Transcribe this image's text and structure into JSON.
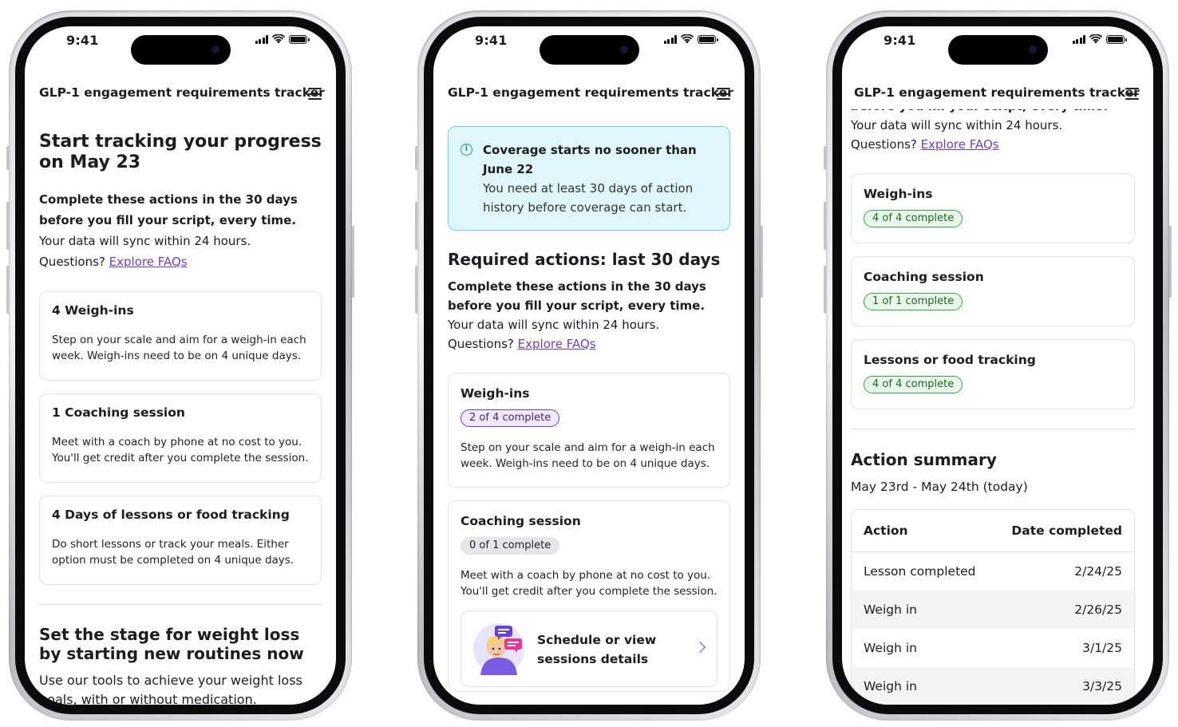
{
  "status_bar": {
    "time": "9:41"
  },
  "app": {
    "title": "GLP-1 engagement requirements tracker"
  },
  "screen1": {
    "heading": "Start tracking your progress on May 23",
    "intro_bold": "Complete these actions in the 30 days before you fill your script, every time.",
    "sync_text": "Your data will sync within 24 hours.",
    "questions_text": "Questions?",
    "faq_link": "Explore FAQs",
    "cards": [
      {
        "title": "4 Weigh-ins",
        "body": "Step on your scale and aim for a weigh-in each week. Weigh-ins need to be on 4 unique days."
      },
      {
        "title": "1 Coaching session",
        "body": "Meet with a coach by phone at no cost to you. You'll get credit after you complete the session."
      },
      {
        "title": "4 Days of lessons or food tracking",
        "body": "Do short lessons or track your meals. Either option must be completed on 4 unique days."
      }
    ],
    "section2_heading": "Set the stage for weight loss by starting new routines now",
    "section2_body": "Use our tools to achieve your weight loss goals, with or without medication."
  },
  "screen2": {
    "info_title": "Coverage starts no sooner than June 22",
    "info_body": "You need at least 30 days of action history before coverage can start.",
    "heading": "Required actions: last 30 days",
    "intro_bold": "Complete these actions in the 30 days before you fill your script, every time.",
    "sync_text": "Your data will sync within 24 hours.",
    "questions_text": "Questions?",
    "faq_link": "Explore FAQs",
    "weighins": {
      "title": "Weigh-ins",
      "status": "2 of 4 complete",
      "body": "Step on your scale and aim for a weigh-in each week. Weigh-ins need to be on 4 unique days."
    },
    "coaching": {
      "title": "Coaching session",
      "status": "0 of 1 complete",
      "body": "Meet with a coach by phone at no cost to you. You'll get credit after you complete the session."
    },
    "schedule_label": "Schedule or view sessions details"
  },
  "screen3": {
    "partial_top": "before you fill your script, every time.",
    "sync_text": "Your data will sync within 24 hours.",
    "questions_text": "Questions?",
    "faq_link": "Explore FAQs",
    "cards": [
      {
        "title": "Weigh-ins",
        "status": "4 of 4 complete"
      },
      {
        "title": "Coaching session",
        "status": "1 of 1 complete"
      },
      {
        "title": "Lessons or food tracking",
        "status": "4 of 4 complete"
      }
    ],
    "summary_heading": "Action summary",
    "summary_range": "May 23rd - May 24th (today)",
    "table": {
      "headers": [
        "Action",
        "Date completed"
      ],
      "rows": [
        [
          "Lesson completed",
          "2/24/25"
        ],
        [
          "Weigh in",
          "2/26/25"
        ],
        [
          "Weigh in",
          "3/1/25"
        ],
        [
          "Weigh in",
          "3/3/25"
        ]
      ]
    }
  },
  "colors": {
    "link": "#6a3fd8",
    "info_bg": "#dff7fb",
    "info_border": "#6fd6e6",
    "success": "#37a83e",
    "progress": "#6a3fd8"
  }
}
